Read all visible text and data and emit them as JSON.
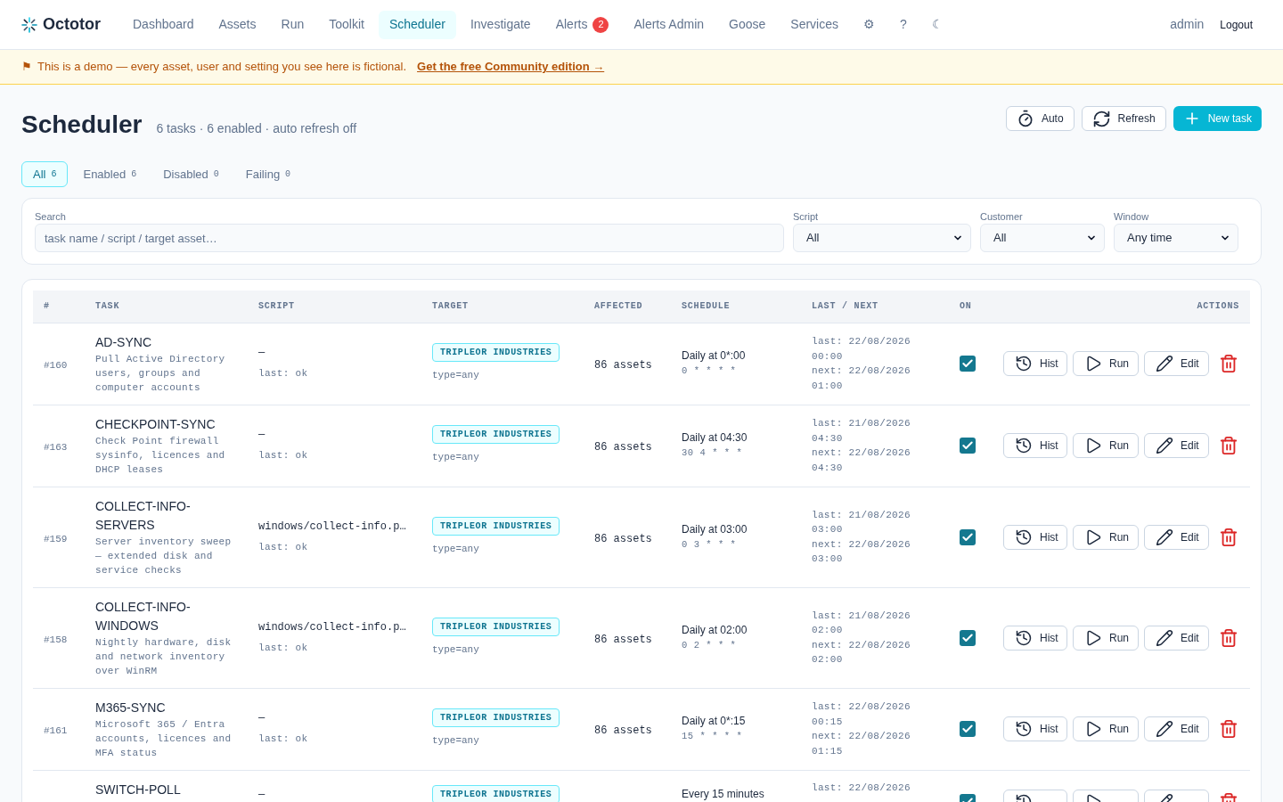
{
  "nav": {
    "brand": "Octotor",
    "items": [
      {
        "label": "Dashboard",
        "selected": false
      },
      {
        "label": "Assets",
        "selected": false
      },
      {
        "label": "Run",
        "selected": false
      },
      {
        "label": "Toolkit",
        "selected": false
      },
      {
        "label": "Scheduler",
        "selected": true
      },
      {
        "label": "Investigate",
        "selected": false
      },
      {
        "label": "Alerts",
        "selected": false,
        "badge": "2"
      },
      {
        "label": "Alerts Admin",
        "selected": false
      },
      {
        "label": "Goose",
        "selected": false
      },
      {
        "label": "Services",
        "selected": false
      }
    ],
    "tools": [
      "⚙",
      "?",
      "☾"
    ],
    "user": "admin",
    "logout": "Logout"
  },
  "banner": {
    "flag": "⚑",
    "text": "This is a demo — every asset, user and setting you see here is fictional.",
    "link": "Get the free Community edition →"
  },
  "header": {
    "title": "Scheduler",
    "summary": "6 tasks · 6 enabled · auto refresh off",
    "buttons": [
      {
        "kind": "timer",
        "label": "Auto"
      },
      {
        "kind": "refresh",
        "label": "Refresh"
      },
      {
        "kind": "new",
        "label": "New task"
      }
    ]
  },
  "tabs": [
    {
      "label": "All",
      "count": "6",
      "selected": true
    },
    {
      "label": "Enabled",
      "count": "6",
      "selected": false
    },
    {
      "label": "Disabled",
      "count": "0",
      "selected": false
    },
    {
      "label": "Failing",
      "count": "0",
      "selected": false
    }
  ],
  "filters": {
    "search": {
      "label": "Search",
      "placeholder": "task name / script / target asset…"
    },
    "selects": [
      {
        "label": "Script",
        "value": "All"
      },
      {
        "label": "Customer",
        "value": "All"
      },
      {
        "label": "Window",
        "value": "Any time"
      }
    ]
  },
  "table": {
    "columns": [
      "#",
      "TASK",
      "SCRIPT",
      "TARGET",
      "AFFECTED",
      "SCHEDULE",
      "LAST / NEXT",
      "ON",
      "ACTIONS"
    ],
    "rows": [
      {
        "id": "#160",
        "name": "AD-SYNC",
        "description": "Pull Active Directory users, groups and computer accounts",
        "script": "—",
        "script_status": "last: ok",
        "target": "TRIPLEOR INDUSTRIES",
        "target_filter": "type=any",
        "affected": "86 assets",
        "schedule": "Daily at 0*:00",
        "cron": "0 * * * *",
        "last": "last: 22/08/2026 00:00",
        "next": "next: 22/08/2026 01:00",
        "on": true,
        "actions": [
          {
            "kind": "history",
            "label": "Hist"
          },
          {
            "kind": "run",
            "label": "Run"
          },
          {
            "kind": "edit",
            "label": "Edit"
          },
          {
            "kind": "delete"
          }
        ]
      },
      {
        "id": "#163",
        "name": "CHECKPOINT-SYNC",
        "description": "Check Point firewall sysinfo, licences and DHCP leases",
        "script": "—",
        "script_status": "last: ok",
        "target": "TRIPLEOR INDUSTRIES",
        "target_filter": "type=any",
        "affected": "86 assets",
        "schedule": "Daily at 04:30",
        "cron": "30 4 * * *",
        "last": "last: 21/08/2026 04:30",
        "next": "next: 22/08/2026 04:30",
        "on": true,
        "actions": [
          {
            "kind": "history",
            "label": "Hist"
          },
          {
            "kind": "run",
            "label": "Run"
          },
          {
            "kind": "edit",
            "label": "Edit"
          },
          {
            "kind": "delete"
          }
        ]
      },
      {
        "id": "#159",
        "name": "COLLECT-INFO-SERVERS",
        "description": "Server inventory sweep — extended disk and service checks",
        "script": "windows/collect-info.p…",
        "script_status": "last: ok",
        "target": "TRIPLEOR INDUSTRIES",
        "target_filter": "type=any",
        "affected": "86 assets",
        "schedule": "Daily at 03:00",
        "cron": "0 3 * * *",
        "last": "last: 21/08/2026 03:00",
        "next": "next: 22/08/2026 03:00",
        "on": true,
        "actions": [
          {
            "kind": "history",
            "label": "Hist"
          },
          {
            "kind": "run",
            "label": "Run"
          },
          {
            "kind": "edit",
            "label": "Edit"
          },
          {
            "kind": "delete"
          }
        ]
      },
      {
        "id": "#158",
        "name": "COLLECT-INFO-WINDOWS",
        "description": "Nightly hardware, disk and network inventory over WinRM",
        "script": "windows/collect-info.p…",
        "script_status": "last: ok",
        "target": "TRIPLEOR INDUSTRIES",
        "target_filter": "type=any",
        "affected": "86 assets",
        "schedule": "Daily at 02:00",
        "cron": "0 2 * * *",
        "last": "last: 21/08/2026 02:00",
        "next": "next: 22/08/2026 02:00",
        "on": true,
        "actions": [
          {
            "kind": "history",
            "label": "Hist"
          },
          {
            "kind": "run",
            "label": "Run"
          },
          {
            "kind": "edit",
            "label": "Edit"
          },
          {
            "kind": "delete"
          }
        ]
      },
      {
        "id": "#161",
        "name": "M365-SYNC",
        "description": "Microsoft 365 / Entra accounts, licences and MFA status",
        "script": "—",
        "script_status": "last: ok",
        "target": "TRIPLEOR INDUSTRIES",
        "target_filter": "type=any",
        "affected": "86 assets",
        "schedule": "Daily at 0*:15",
        "cron": "15 * * * *",
        "last": "last: 22/08/2026 00:15",
        "next": "next: 22/08/2026 01:15",
        "on": true,
        "actions": [
          {
            "kind": "history",
            "label": "Hist"
          },
          {
            "kind": "run",
            "label": "Run"
          },
          {
            "kind": "edit",
            "label": "Edit"
          },
          {
            "kind": "delete"
          }
        ]
      },
      {
        "name": "SWITCH-POLL",
        "script": "—",
        "target": "TRIPLEOR INDUSTRIES",
        "schedule": "Every 15 minutes",
        "last": "last: 22/08/2026",
        "on": true,
        "actions": [
          {
            "kind": "history"
          },
          {
            "kind": "run"
          },
          {
            "kind": "edit"
          },
          {
            "kind": "delete"
          }
        ]
      }
    ]
  }
}
